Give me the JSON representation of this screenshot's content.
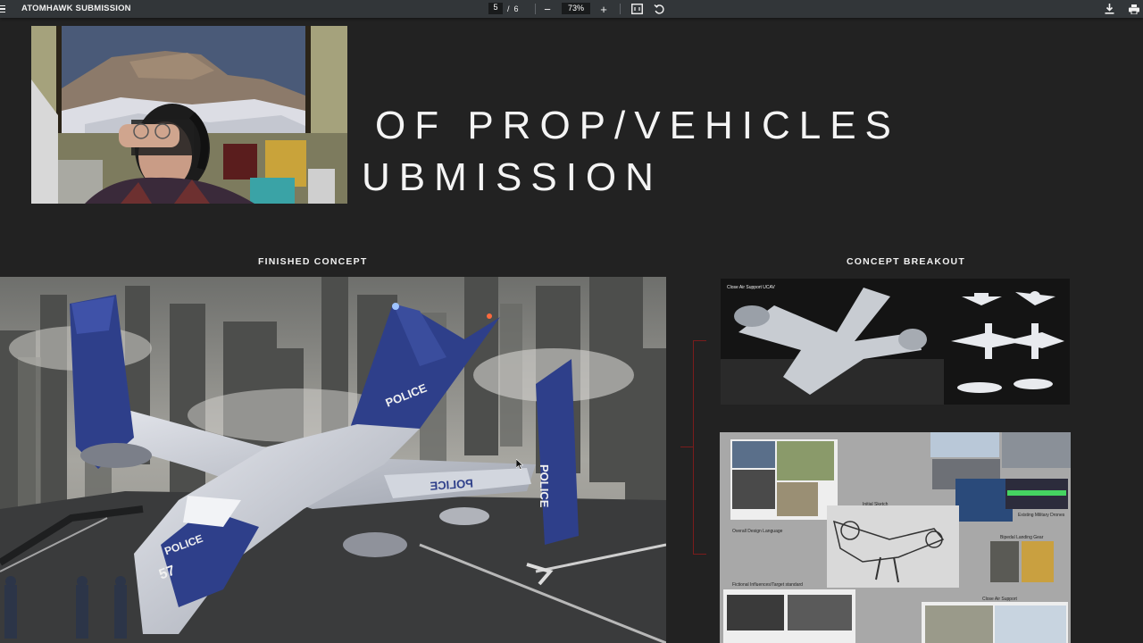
{
  "toolbar": {
    "title": "ATOMHAWK SUBMISSION",
    "page_current": "5",
    "page_separator": "/",
    "page_total": "6",
    "zoom_level": "73%",
    "zoom_out_glyph": "−",
    "zoom_in_glyph": "+",
    "icons": [
      "menu-icon",
      "fit-page-icon",
      "rotate-icon",
      "download-icon",
      "print-icon"
    ]
  },
  "slide": {
    "title_line1": "OF PROP/VEHICLES",
    "title_line2": "UBMISSION",
    "label_finished": "FINISHED CONCEPT",
    "label_breakout": "CONCEPT BREAKOUT"
  },
  "breakout1": {
    "header": "Close Air Support UCAV"
  },
  "breakout2": {
    "initial_sketch": "Initial Sketch",
    "overall_design": "Overall Design Language",
    "existing_drones": "Existing Military Drones",
    "bipedal_gear": "Bipedal Landing Gear",
    "fictional_influences": "Fictional Influences/Target standard",
    "close_air_support": "Close Air Support"
  },
  "main_image": {
    "police_wing": "POLICE",
    "police_fin": "POLICE",
    "police_body": "POLICE",
    "police_tail": "POLICE",
    "unit_number": "57"
  },
  "colors": {
    "background": "#222222",
    "toolbar": "#323639",
    "police_blue": "#2e3f8a",
    "bracket_red": "#7a1c1c"
  }
}
